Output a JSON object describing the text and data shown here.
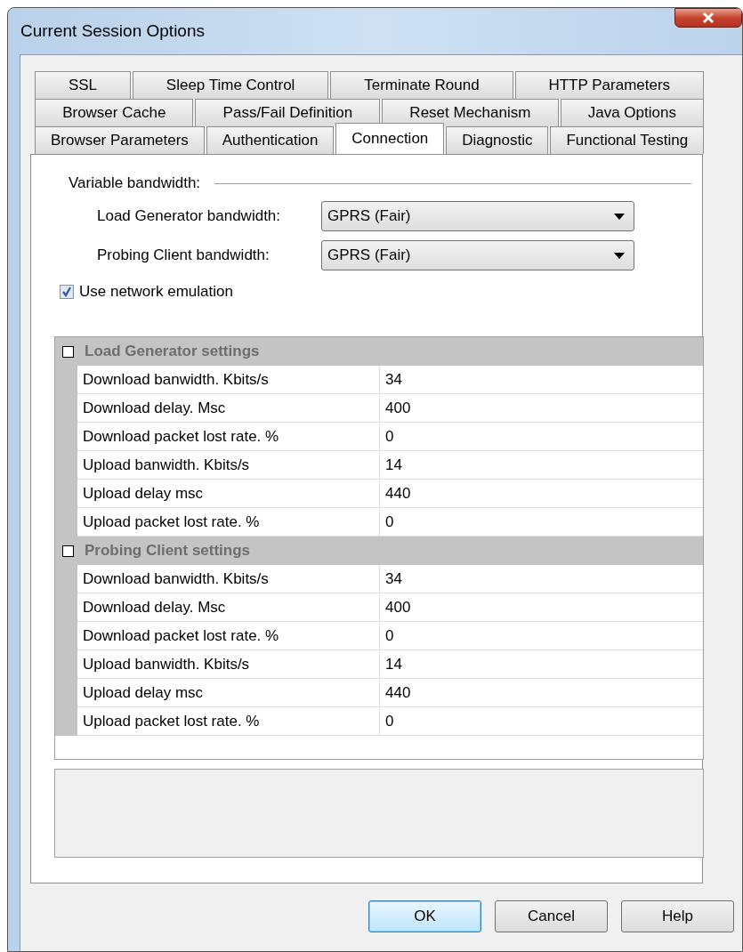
{
  "window": {
    "title": "Current Session Options"
  },
  "tab_rows": [
    [
      {
        "label": "SSL",
        "selected": false
      },
      {
        "label": "Sleep Time Control",
        "selected": false
      },
      {
        "label": "Terminate Round",
        "selected": false
      },
      {
        "label": "HTTP Parameters",
        "selected": false
      }
    ],
    [
      {
        "label": "Browser Cache",
        "selected": false
      },
      {
        "label": "Pass/Fail Definition",
        "selected": false
      },
      {
        "label": "Reset Mechanism",
        "selected": false
      },
      {
        "label": "Java Options",
        "selected": false
      }
    ],
    [
      {
        "label": "Browser Parameters",
        "selected": false
      },
      {
        "label": "Authentication",
        "selected": false
      },
      {
        "label": "Connection",
        "selected": true
      },
      {
        "label": "Diagnostic",
        "selected": false
      },
      {
        "label": "Functional Testing",
        "selected": false
      }
    ]
  ],
  "variable_bandwidth": {
    "heading": "Variable bandwidth:",
    "fields": [
      {
        "label": "Load Generator bandwidth:",
        "value": "GPRS (Fair)"
      },
      {
        "label": "Probing Client bandwidth:",
        "value": "GPRS (Fair)"
      }
    ]
  },
  "use_network_emulation": {
    "label": "Use network emulation",
    "checked": true
  },
  "property_grid": [
    {
      "title": "Load Generator settings",
      "rows": [
        {
          "name": "Download banwidth. Kbits/s",
          "value": "34"
        },
        {
          "name": "Download delay. Msc",
          "value": "400"
        },
        {
          "name": "Download packet lost rate. %",
          "value": "0"
        },
        {
          "name": "Upload banwidth. Kbits/s",
          "value": "14"
        },
        {
          "name": "Upload delay msc",
          "value": "440"
        },
        {
          "name": "Upload packet lost rate. %",
          "value": "0"
        }
      ]
    },
    {
      "title": "Probing Client settings",
      "rows": [
        {
          "name": "Download banwidth. Kbits/s",
          "value": "34"
        },
        {
          "name": "Download delay. Msc",
          "value": "400"
        },
        {
          "name": "Download packet lost rate. %",
          "value": "0"
        },
        {
          "name": "Upload banwidth. Kbits/s",
          "value": "14"
        },
        {
          "name": "Upload delay msc",
          "value": "440"
        },
        {
          "name": "Upload packet lost rate. %",
          "value": "0"
        }
      ]
    }
  ],
  "buttons": [
    {
      "label": "OK",
      "default": true
    },
    {
      "label": "Cancel",
      "default": false
    },
    {
      "label": "Help",
      "default": false
    }
  ]
}
